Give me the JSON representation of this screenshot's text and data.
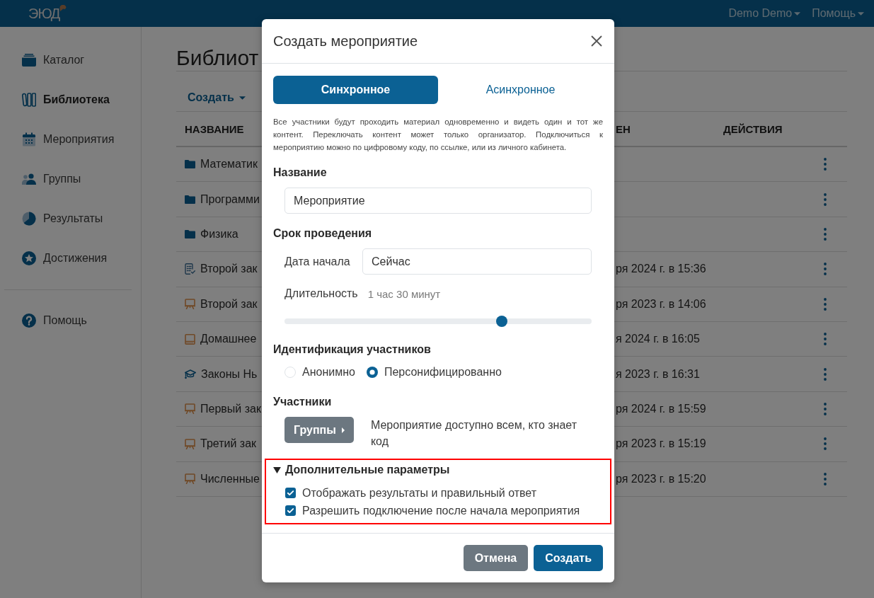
{
  "navbar": {
    "logo": "ЭЮД",
    "menus": [
      "Demo Demo",
      "Помощь"
    ]
  },
  "sidebar": {
    "items": [
      {
        "label": "Каталог",
        "selected": false
      },
      {
        "label": "Библиотека",
        "selected": true
      },
      {
        "label": "Мероприятия",
        "selected": false
      },
      {
        "label": "Группы",
        "selected": false
      },
      {
        "label": "Результаты",
        "selected": false
      },
      {
        "label": "Достижения",
        "selected": false
      }
    ],
    "footer_items": [
      {
        "label": "Помощь",
        "selected": false
      }
    ]
  },
  "page": {
    "title": "Библиот",
    "toolbar": {
      "create": "Создать"
    },
    "table": {
      "columns": [
        "НАЗВАНИЕ",
        "ЕН",
        "ДЕЙСТВИЯ"
      ],
      "rows": [
        {
          "kind": "folder",
          "name": "Математик"
        },
        {
          "kind": "folder",
          "name": "Программи"
        },
        {
          "kind": "folder",
          "name": "Физика"
        },
        {
          "kind": "test",
          "name": "Второй зак",
          "column_2": "ря 2024 г. в 15:36"
        },
        {
          "kind": "lesson",
          "name": "Второй зак",
          "column_2": "ря 2023 г. в 14:06"
        },
        {
          "kind": "homework",
          "name": "Домашнее",
          "column_2": "я 2024 г. в 16:05"
        },
        {
          "kind": "course",
          "name": "Законы Нь",
          "column_2": "я 2023 г. в 16:31"
        },
        {
          "kind": "lesson",
          "name": "Первый зак",
          "column_2": "ря 2024 г. в 15:59"
        },
        {
          "kind": "lesson",
          "name": "Третий зак",
          "column_2": "ря 2023 г. в 15:19"
        },
        {
          "kind": "lesson",
          "name": "Численные",
          "column_2": "ря 2023 г. в 15:20"
        }
      ]
    }
  },
  "modal": {
    "title": "Создать мероприятие",
    "modes": [
      {
        "label": "Синхронное",
        "selected": true
      },
      {
        "label": "Асинхронное",
        "selected": false
      }
    ],
    "description": "Все участники будут проходить материал одновременно и видеть один и тот же контент. Переключать контент может только организатор. Подключиться к мероприятию можно по цифровому коду, по ссылке, или из личного кабинета.",
    "name_field": {
      "label": "Название",
      "value": "Мероприятие"
    },
    "schedule": {
      "label": "Срок проведения",
      "start": {
        "label": "Дата начала",
        "value": "Сейчас"
      },
      "duration": {
        "label": "Длительность",
        "reading": "1 час 30 минут",
        "level": 0.707
      }
    },
    "identification": {
      "label": "Идентификация участников",
      "options": [
        {
          "label": "Анонимно",
          "selected": false
        },
        {
          "label": "Персонифицированно",
          "selected": true
        }
      ]
    },
    "participants": {
      "label": "Участники",
      "button": "Группы",
      "note": "Мероприятие доступно всем, кто знает код"
    },
    "advanced": {
      "label": "Дополнительные параметры",
      "expanded": true,
      "highlighted": true,
      "options": [
        {
          "label": "Отображать результаты и правильный ответ",
          "checked": true
        },
        {
          "label": "Разрешить подключение после начала мероприятия",
          "checked": true
        }
      ]
    },
    "buttons": [
      {
        "label": "Отмена",
        "kind": "secondary"
      },
      {
        "label": "Создать",
        "kind": "primary"
      }
    ]
  }
}
